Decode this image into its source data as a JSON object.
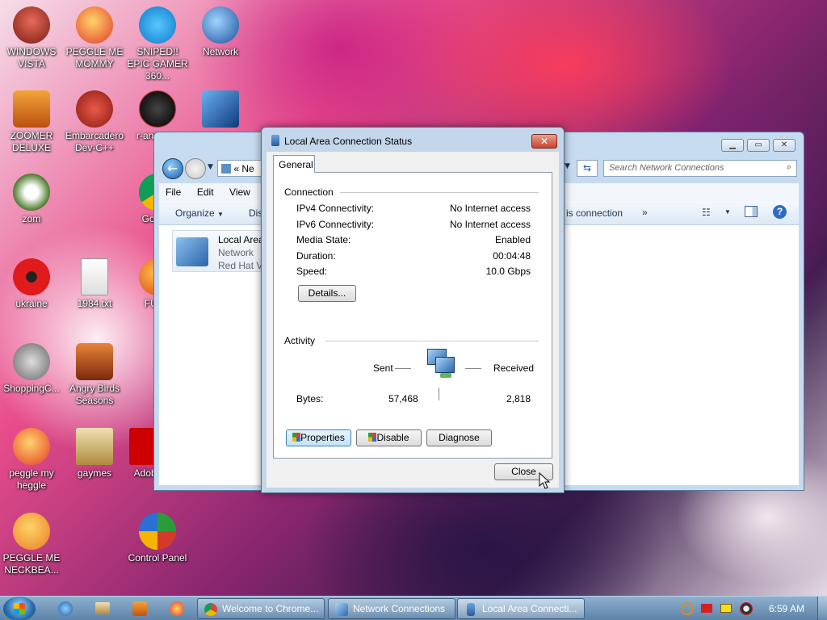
{
  "desktop": {
    "icons": [
      {
        "label": "WINDOWS VISTA",
        "icon": "vista-icon",
        "color": "#c0392b"
      },
      {
        "label": "PEGGLE ME MOMMY",
        "icon": "peggle-icon",
        "color": "#e74c3c"
      },
      {
        "label": "SNIPED!! EPIC GAMER 360...",
        "icon": "skype-icon",
        "color": "#1aa3e8"
      },
      {
        "label": "Network",
        "icon": "network-globe-icon",
        "color": "#2470c4"
      },
      {
        "label": "ZOOMER DELUXE",
        "icon": "zoomer-icon",
        "color": "#e0781a"
      },
      {
        "label": "Embarcadero Dev-C++",
        "icon": "devcpp-icon",
        "color": "#c0392b"
      },
      {
        "label": "r-ant para",
        "icon": "r-ant-icon",
        "color": "#222"
      },
      {
        "label": "",
        "icon": "monitor-icon",
        "color": "#2c5aa0"
      },
      {
        "label": "zom",
        "icon": "flower-icon",
        "color": "#4a7a2a"
      },
      {
        "label": "Go Chr",
        "icon": "chrome-icon",
        "color": "#2f9e44"
      },
      {
        "label": "ukraine",
        "icon": "radiation-icon",
        "color": "#d91b1b"
      },
      {
        "label": "1984.txt",
        "icon": "text-file-icon",
        "color": "#f0f0f0"
      },
      {
        "label": "FURY",
        "icon": "firefox-icon",
        "color": "#e8641a"
      },
      {
        "label": "ShoppingC...",
        "icon": "flash-icon",
        "color": "#777"
      },
      {
        "label": "Angry Birds Seasons",
        "icon": "angry-birds-icon",
        "color": "#c44d1a"
      },
      {
        "label": "peggle my heggle",
        "icon": "peggle-icon",
        "color": "#e74c3c"
      },
      {
        "label": "gaymes",
        "icon": "folder-icon",
        "color": "#c0a060"
      },
      {
        "label": "Adobe",
        "icon": "adobe-icon",
        "color": "#c00"
      },
      {
        "label": "PEGGLE ME NECKBEA...",
        "icon": "peggle-icon",
        "color": "#e67e22"
      },
      {
        "label": "Control Panel",
        "icon": "control-panel-icon",
        "color": "#c89020"
      }
    ]
  },
  "explorer": {
    "breadcrumb_prefix": "«",
    "breadcrumb_text": "Ne",
    "search_placeholder": "Search Network Connections",
    "menu": [
      "File",
      "Edit",
      "View",
      "T"
    ],
    "toolbar": {
      "organize": "Organize",
      "dis": "Dis",
      "this_connection": "is connection",
      "more": "»"
    },
    "item": {
      "name": "Local Area",
      "type": "Network",
      "adapter": "Red Hat Vi"
    }
  },
  "dialog": {
    "title": "Local Area Connection Status",
    "tab": "General",
    "connection_header": "Connection",
    "rows": [
      {
        "label": "IPv4 Connectivity:",
        "value": "No Internet access"
      },
      {
        "label": "IPv6 Connectivity:",
        "value": "No Internet access"
      },
      {
        "label": "Media State:",
        "value": "Enabled"
      },
      {
        "label": "Duration:",
        "value": "00:04:48"
      },
      {
        "label": "Speed:",
        "value": "10.0 Gbps"
      }
    ],
    "details_button": "Details...",
    "activity_header": "Activity",
    "sent_label": "Sent",
    "received_label": "Received",
    "bytes_label": "Bytes:",
    "bytes_sent": "57,468",
    "bytes_received": "2,818",
    "properties_button": "Properties",
    "disable_button": "Disable",
    "diagnose_button": "Diagnose",
    "close_button": "Close"
  },
  "taskbar": {
    "tasks": [
      {
        "label": "Welcome to Chrome...",
        "icon": "chrome-icon"
      },
      {
        "label": "Network Connections",
        "icon": "network-connections-icon"
      },
      {
        "label": "Local Area Connecti...",
        "icon": "network-status-icon"
      }
    ],
    "time": "6:59 AM"
  }
}
